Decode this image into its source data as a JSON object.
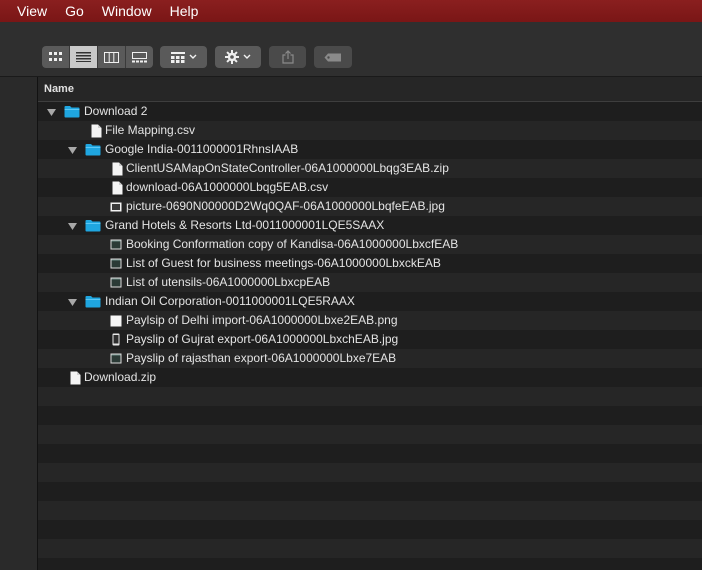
{
  "menubar": {
    "items": [
      "View",
      "Go",
      "Window",
      "Help"
    ]
  },
  "toolbar": {
    "view_modes": [
      "icon-view",
      "list-view",
      "column-view",
      "gallery-view"
    ],
    "active_view": "list-view",
    "group_menu": "group-by",
    "action_menu": "action",
    "share": "share",
    "tags": "tags"
  },
  "list": {
    "column_header": "Name",
    "items": [
      {
        "name": "Download 2",
        "kind": "folder",
        "level": 0,
        "expanded": true
      },
      {
        "name": "File Mapping.csv",
        "kind": "doc",
        "level": 1
      },
      {
        "name": "Google India-0011000001RhnsIAAB",
        "kind": "folder",
        "level": 1,
        "expanded": true
      },
      {
        "name": "ClientUSAMapOnStateController-06A1000000Lbqg3EAB.zip",
        "kind": "doc",
        "level": 2
      },
      {
        "name": "download-06A1000000Lbqg5EAB.csv",
        "kind": "doc",
        "level": 2
      },
      {
        "name": "picture-0690N00000D2Wq0QAF-06A1000000LbqfeEAB.jpg",
        "kind": "image",
        "level": 2
      },
      {
        "name": "Grand Hotels & Resorts Ltd-0011000001LQE5SAAX",
        "kind": "folder",
        "level": 1,
        "expanded": true
      },
      {
        "name": "Booking Conformation copy of Kandisa-06A1000000LbxcfEAB",
        "kind": "generic",
        "level": 2
      },
      {
        "name": "List of Guest for business meetings-06A1000000LbxckEAB",
        "kind": "generic",
        "level": 2
      },
      {
        "name": "List of utensils-06A1000000LbxcpEAB",
        "kind": "generic",
        "level": 2
      },
      {
        "name": "Indian Oil Corporation-0011000001LQE5RAAX",
        "kind": "folder",
        "level": 1,
        "expanded": true
      },
      {
        "name": "Paylsip of Delhi import-06A1000000Lbxe2EAB.png",
        "kind": "blank",
        "level": 2
      },
      {
        "name": "Payslip of Gujrat export-06A1000000LbxchEAB.jpg",
        "kind": "phone",
        "level": 2
      },
      {
        "name": "Payslip of rajasthan export-06A1000000Lbxe7EAB",
        "kind": "generic",
        "level": 2
      },
      {
        "name": "Download.zip",
        "kind": "doc",
        "level": 0
      }
    ]
  },
  "colors": {
    "menubar": "#7e1919",
    "folder": "#1fa6e0",
    "row_even": "#1e1e1e",
    "row_odd": "#262626"
  }
}
